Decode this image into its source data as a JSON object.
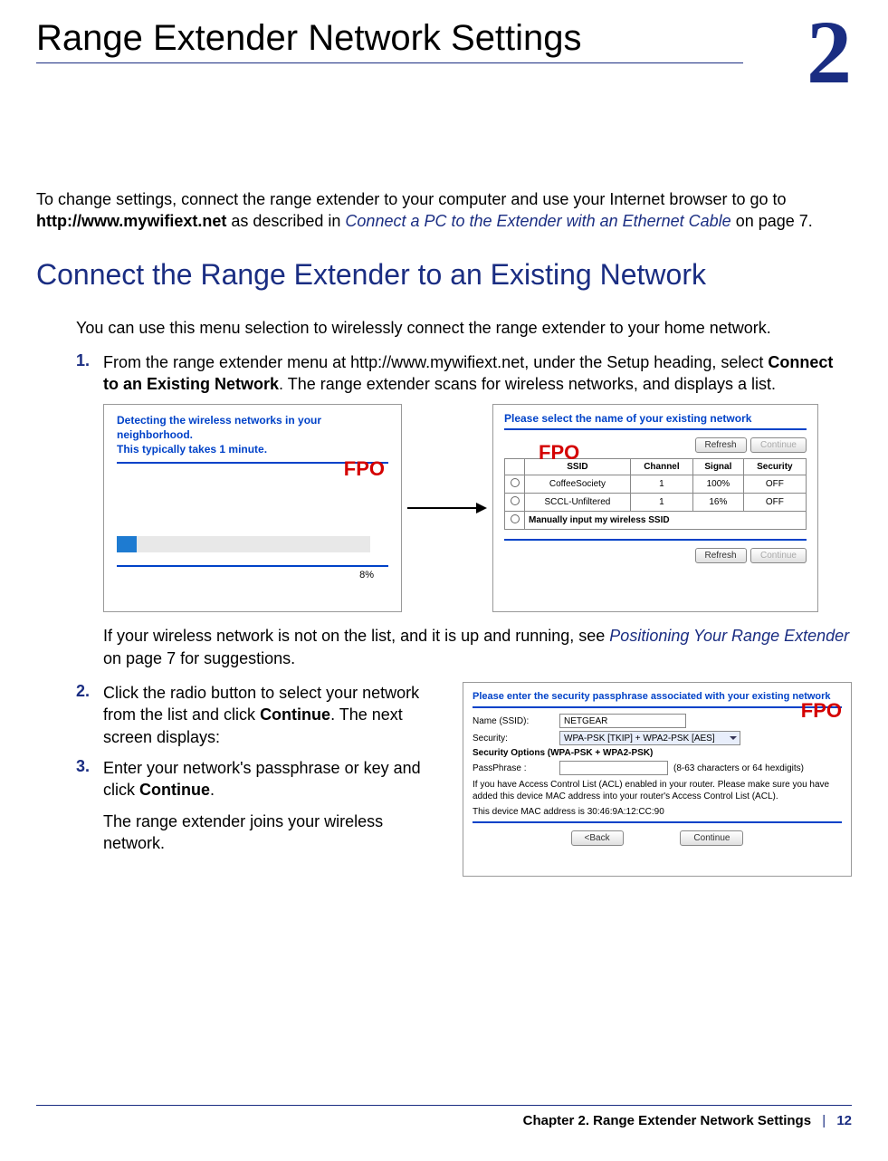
{
  "chapter": {
    "number": "2",
    "title": "Range Extender Network Settings"
  },
  "intro": {
    "part1": "To change settings, connect the range extender to your computer and use your Internet browser to go to ",
    "url": "http://www.mywifiext.net",
    "part2": " as described in ",
    "linkref": "Connect a PC to the Extender with an Ethernet Cable",
    "part3": " on page 7."
  },
  "section1": {
    "heading": "Connect the Range Extender to an Existing Network",
    "intro": "You can use this menu selection to wirelessly connect the range extender to your home network.",
    "step1": {
      "num": "1.",
      "a": "From the range extender menu at http://www.mywifiext.net, under the Setup heading, select ",
      "b": "Connect to an Existing Network",
      "c": ". The range extender scans for wireless networks, and displays a list."
    },
    "fig1": {
      "line1": "Detecting the wireless networks in your neighborhood.",
      "line2": "This typically takes 1 minute.",
      "pct": "8%",
      "fpo": "FPO"
    },
    "fig2": {
      "title": "Please select the name of your existing network",
      "refresh": "Refresh",
      "continue": "Continue",
      "headers": {
        "ssid": "SSID",
        "channel": "Channel",
        "signal": "Signal",
        "security": "Security"
      },
      "rows": [
        {
          "ssid": "CoffeeSociety",
          "channel": "1",
          "signal": "100%",
          "security": "OFF"
        },
        {
          "ssid": "SCCL-Unfiltered",
          "channel": "1",
          "signal": "16%",
          "security": "OFF"
        }
      ],
      "manual": "Manually input my wireless SSID",
      "fpo": "FPO"
    },
    "afterfig": {
      "a": "If your wireless network is not on the list, and it is up and running, see ",
      "link": "Positioning Your Range Extender",
      "b": " on page 7 for suggestions."
    },
    "step2": {
      "num": "2.",
      "a": "Click the radio button to select your network from the list and click ",
      "b": "Continue",
      "c": ". The next screen displays:"
    },
    "step3": {
      "num": "3.",
      "a": "Enter your network's passphrase or key and click ",
      "b": "Continue",
      "c": "."
    },
    "step3_after": "The range extender joins your wireless network.",
    "fig3": {
      "hdr": "Please enter the security passphrase associated with your existing network",
      "name_lbl": "Name (SSID):",
      "name_val": "NETGEAR",
      "sec_lbl": "Security:",
      "sec_val": "WPA-PSK [TKIP] + WPA2-PSK [AES]",
      "opts": "Security Options (WPA-PSK + WPA2-PSK)",
      "pass_lbl": "PassPhrase :",
      "pass_hint": "(8-63 characters or 64 hexdigits)",
      "acl": "If you have Access Control List (ACL) enabled in your router. Please make sure you have added this device MAC address into your router's Access Control List (ACL).",
      "mac": "This device MAC address is 30:46:9A:12:CC:90",
      "back": "<Back",
      "cont": "Continue",
      "fpo": "FPO"
    }
  },
  "footer": {
    "chapter": "Chapter 2.  Range Extender Network Settings",
    "sep": "|",
    "page": "12"
  }
}
